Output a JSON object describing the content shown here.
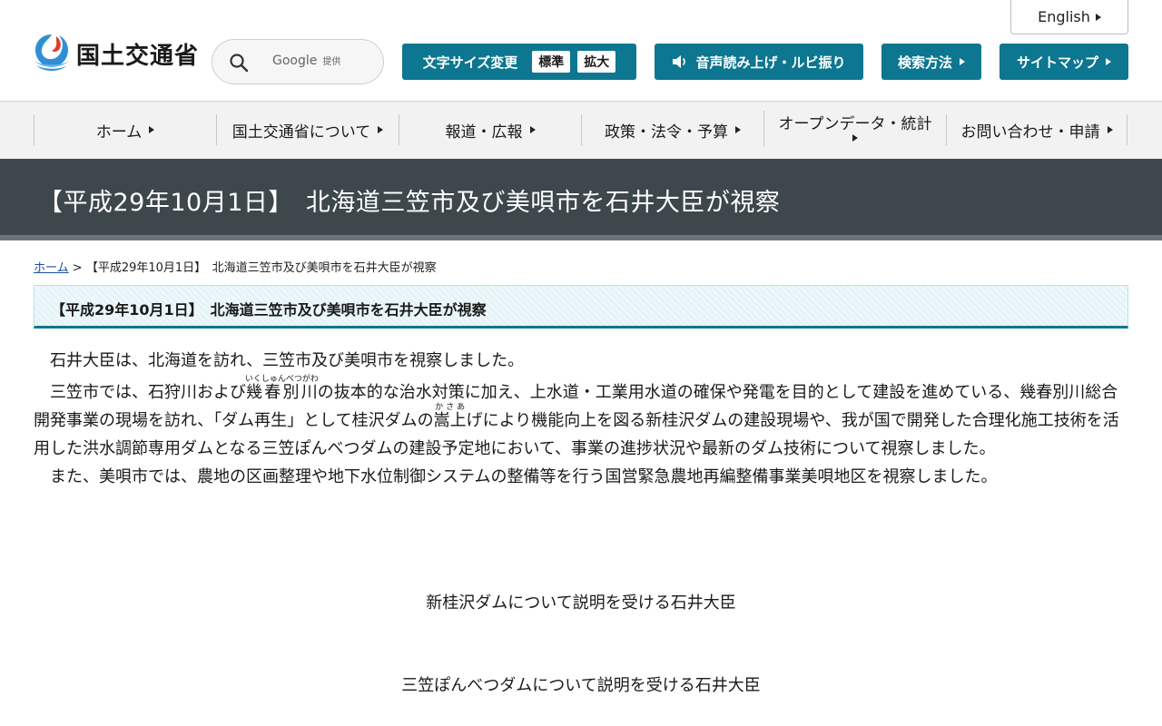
{
  "header": {
    "english_label": "English",
    "logo_text": "国土交通省",
    "search": {
      "placeholder": "",
      "google_label": "Google",
      "provided_label": "提供"
    },
    "text_size": {
      "label": "文字サイズ変更",
      "standard": "標準",
      "enlarge": "拡大"
    },
    "speech_label": "音声読み上げ・ルビ振り",
    "search_method_label": "検索方法",
    "sitemap_label": "サイトマップ"
  },
  "nav": {
    "items": [
      {
        "label": "ホーム"
      },
      {
        "label": "国土交通省について"
      },
      {
        "label": "報道・広報"
      },
      {
        "label": "政策・法令・予算"
      },
      {
        "label": "オープンデータ・統計"
      },
      {
        "label": "お問い合わせ・申請"
      }
    ]
  },
  "page": {
    "title": "【平成29年10月1日】　北海道三笠市及び美唄市を石井大臣が視察",
    "breadcrumb": {
      "home": "ホーム",
      "separator": ">",
      "current": "【平成29年10月1日】　北海道三笠市及び美唄市を石井大臣が視察"
    },
    "heading": "【平成29年10月1日】　北海道三笠市及び美唄市を石井大臣が視察",
    "paragraphs": {
      "p1": "石井大臣は、北海道を訪れ、三笠市及び美唄市を視察しました。",
      "p2_a": "三笠市では、石狩川および",
      "p2_ruby1": "幾春別川",
      "p2_ruby1_reading": "いくしゅんべつがわ",
      "p2_b": "の抜本的な治水対策に加え、上水道・工業用水道の確保や発電を目的として建設を進めている、幾春別川総合開発事業の現場を訪れ、「ダム再生」として桂沢ダムの",
      "p2_ruby2": "嵩上",
      "p2_ruby2_reading": "かさあ",
      "p2_c": "げにより機能向上を図る新桂沢ダムの建設現場や、我が国で開発した合理化施工技術を活用した洪水調節専用ダムとなる三笠ぽんべつダムの建設予定地において、事業の進捗状況や最新のダム技術について視察しました。",
      "p3": "また、美唄市では、農地の区画整理や地下水位制御システムの整備等を行う国営緊急農地再編整備事業美唄地区を視察しました。"
    },
    "captions": [
      "新桂沢ダムについて説明を受ける石井大臣",
      "三笠ぽんべつダムについて説明を受ける石井大臣"
    ]
  },
  "colors": {
    "accent": "#0d7690",
    "title_band": "#3d474c",
    "nav_bg": "#f2f2f2"
  }
}
